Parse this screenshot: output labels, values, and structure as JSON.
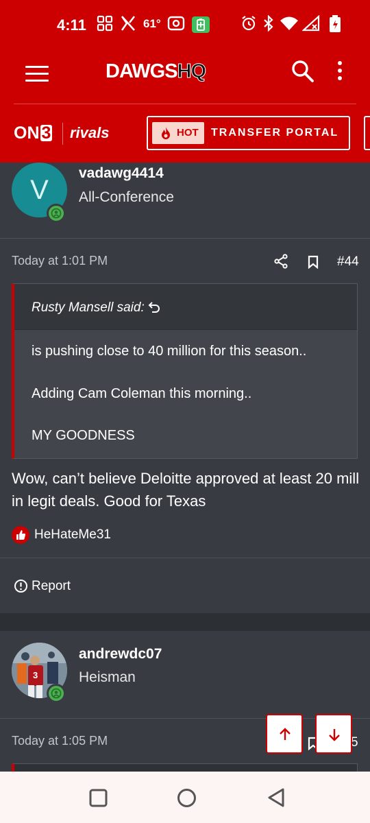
{
  "status_bar": {
    "time": "4:11",
    "temperature": "61°",
    "icons": [
      "grid-icon",
      "x-logo-icon",
      "radio-icon",
      "battery-saver-icon",
      "alarm-icon",
      "bluetooth-icon",
      "wifi-icon",
      "signal-icon",
      "battery-icon"
    ]
  },
  "header": {
    "logo_main": "DAWGS",
    "logo_accent": "HQ",
    "icons": [
      "menu-icon",
      "search-icon",
      "more-icon"
    ]
  },
  "partner_bar": {
    "on3_prefix": "ON",
    "on3_suffix": "3",
    "rivals": "rivals",
    "hot_label": "HOT",
    "portal_label": "TRANSFER PORTAL"
  },
  "posts": [
    {
      "username": "vadawg4414",
      "user_title": "All-Conference",
      "avatar_letter": "V",
      "avatar_color": "#178c92",
      "time": "Today at 1:01 PM",
      "number": "#44",
      "quote": {
        "author": "Rusty Mansell said:",
        "lines": [
          "is pushing close to 40 million for this season..",
          "Adding Cam Coleman this morning..",
          "MY GOODNESS"
        ]
      },
      "message": "Wow, can’t believe Deloitte approved at least 20 mill in legit deals. Good for Texas",
      "reaction_user": "HeHateMe31",
      "report_label": "Report"
    },
    {
      "username": "andrewdc07",
      "user_title": "Heisman",
      "time": "Today at 1:05 PM",
      "number_partial": "5"
    }
  ],
  "colors": {
    "brand_red": "#cc0000",
    "page_bg": "#383c42",
    "online_green": "#4caf50"
  }
}
